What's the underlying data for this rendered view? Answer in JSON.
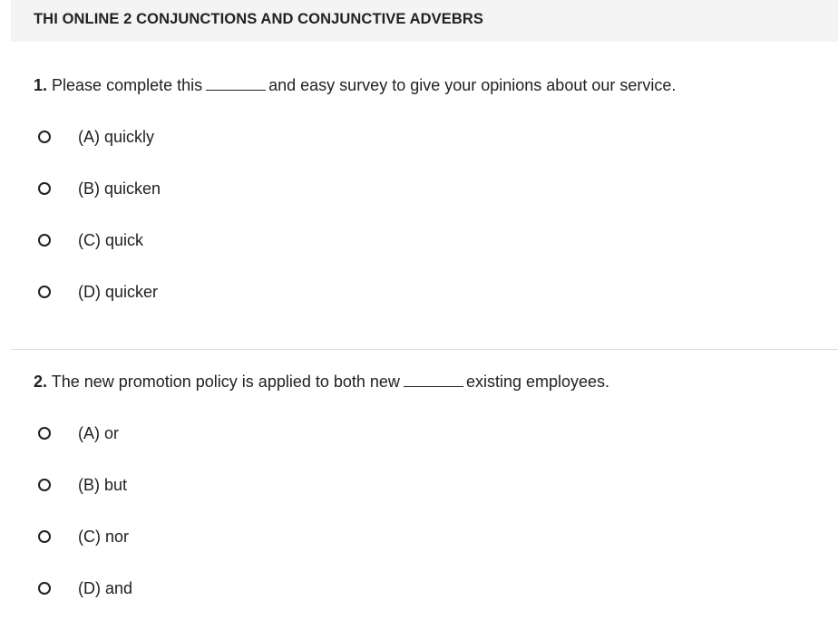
{
  "header": {
    "title": "THI ONLINE 2 CONJUNCTIONS AND CONJUNCTIVE ADVEBRS"
  },
  "questions": [
    {
      "number": "1.",
      "text_before": "Please complete this",
      "text_after": "and easy survey to give your opinions about our service.",
      "options": [
        "(A) quickly",
        "(B) quicken",
        "(C) quick",
        "(D) quicker"
      ]
    },
    {
      "number": "2.",
      "text_before": "The new promotion policy is applied to both new",
      "text_after": "existing employees.",
      "options": [
        "(A) or",
        "(B) but",
        "(C) nor",
        "(D) and"
      ]
    }
  ]
}
